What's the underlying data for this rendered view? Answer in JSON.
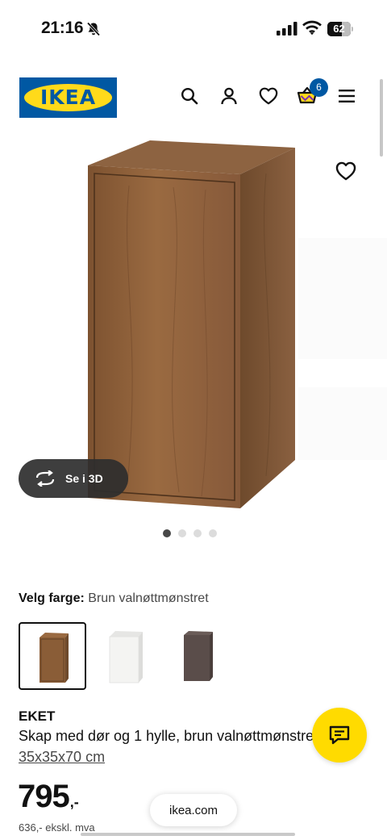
{
  "status_bar": {
    "time": "21:16",
    "battery_level": "62",
    "battery_fraction": 0.62
  },
  "header": {
    "logo_text": "IKEA",
    "cart_count": "6",
    "icons": [
      "search-icon",
      "user-icon",
      "heart-icon",
      "cart-icon",
      "hamburger-menu-icon"
    ]
  },
  "gallery": {
    "view_3d_label": "Se i 3D",
    "image_count": 4,
    "active_index": 0
  },
  "color_select": {
    "label": "Velg farge:",
    "value": "Brun valnøttmønstret",
    "options": [
      {
        "name": "brown-walnut",
        "color": "#8a5d37",
        "selected": true
      },
      {
        "name": "white",
        "color": "#f4f4f2",
        "selected": false
      },
      {
        "name": "dark-grey",
        "color": "#5a4d4a",
        "selected": false
      }
    ]
  },
  "product": {
    "name": "EKET",
    "description": "Skap med dør og 1 hylle, brun valnøttmønstret",
    "size": "35x35x70 cm",
    "price": "795",
    "price_suffix": ",-",
    "price_excl_vat": "636,- ekskl. mva"
  },
  "browser": {
    "url": "ikea.com"
  },
  "colors": {
    "brand_blue": "#0058a3",
    "brand_yellow": "#ffda1a",
    "chat_yellow": "#ffdb00"
  }
}
